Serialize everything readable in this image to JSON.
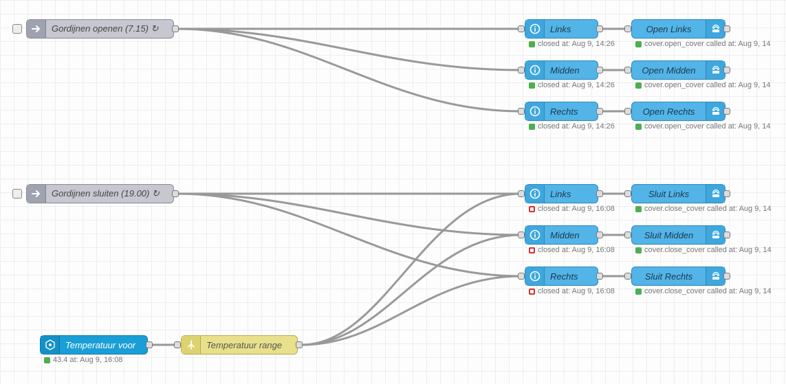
{
  "nodes": {
    "inject_open": {
      "label": "Gordijnen openen (7.15) ↻"
    },
    "inject_close": {
      "label": "Gordijnen sluiten (19.00) ↻"
    },
    "temp_sensor": {
      "label": "Temperatuur voor",
      "status": "43.4 at: Aug 9, 16:08"
    },
    "temp_range": {
      "label": "Temperatuur range"
    },
    "state_open_links": {
      "label": "Links",
      "status": "closed at: Aug 9, 14:26"
    },
    "state_open_midden": {
      "label": "Midden",
      "status": "closed at: Aug 9, 14:26"
    },
    "state_open_rechts": {
      "label": "Rechts",
      "status": "closed at: Aug 9, 14:26"
    },
    "state_close_links": {
      "label": "Links",
      "status": "closed at: Aug 9, 16:08"
    },
    "state_close_midden": {
      "label": "Midden",
      "status": "closed at: Aug 9, 16:08"
    },
    "state_close_rechts": {
      "label": "Rechts",
      "status": "closed at: Aug 9, 16:08"
    },
    "act_open_links": {
      "label": "Open Links",
      "status": "cover.open_cover called at: Aug 9, 14"
    },
    "act_open_midden": {
      "label": "Open Midden",
      "status": "cover.open_cover called at: Aug 9, 14"
    },
    "act_open_rechts": {
      "label": "Open Rechts",
      "status": "cover.open_cover called at: Aug 9, 14"
    },
    "act_close_links": {
      "label": "Sluit Links",
      "status": "cover.close_cover called at: Aug 9, 14"
    },
    "act_close_midden": {
      "label": "Sluit Midden",
      "status": "cover.close_cover called at: Aug 9, 14"
    },
    "act_close_rechts": {
      "label": "Sluit Rechts",
      "status": "cover.close_cover called at: Aug 9, 14"
    }
  }
}
